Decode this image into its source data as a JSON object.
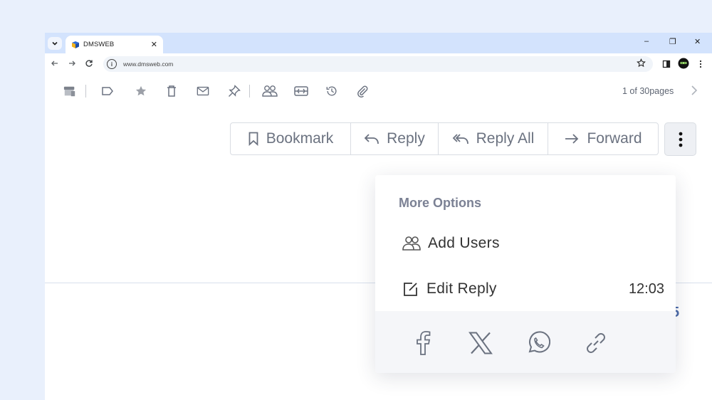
{
  "browser": {
    "tab_title": "DMSWEB",
    "url": "www.dmsweb.com",
    "tab_close": "✕",
    "minimize": "–",
    "restore": "❐",
    "close": "✕"
  },
  "toolbar": {
    "icons": [
      "archive-icon",
      "label-icon",
      "star-icon",
      "trash-icon",
      "mail-icon",
      "pin-icon",
      "users-icon",
      "snooze-icon",
      "history-icon",
      "attachment-icon"
    ],
    "pages_text": "1 of 30pages"
  },
  "actions": {
    "bookmark": "Bookmark",
    "reply": "Reply",
    "reply_all": "Reply All",
    "forward": "Forward"
  },
  "background_digit": "5",
  "menu": {
    "header": "More Options",
    "add_users": "Add Users",
    "edit_reply": "Edit Reply",
    "edit_reply_time": "12:03",
    "share_icons": [
      "facebook-icon",
      "x-icon",
      "whatsapp-icon",
      "link-icon"
    ]
  },
  "colors": {
    "page_bg": "#e9f0fc",
    "titlebar": "#d3e3fd",
    "icon_gray": "#6b7280",
    "accent_blue": "#4b6aa8"
  }
}
